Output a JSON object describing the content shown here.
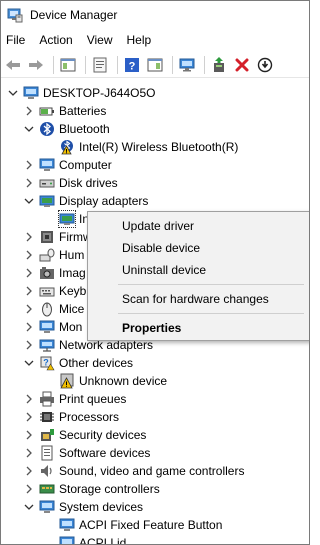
{
  "window": {
    "title": "Device Manager",
    "icon": "device-manager-icon"
  },
  "menu": {
    "file": "File",
    "action": "Action",
    "view": "View",
    "help": "Help"
  },
  "toolbar": {
    "buttons": [
      "back-arrow-icon",
      "forward-arrow-icon",
      "show-hide-tree-icon",
      "properties-icon",
      "help-icon",
      "action-pane-icon",
      "monitor-scan-icon",
      "update-driver-icon",
      "uninstall-x-icon",
      "download-circle-icon"
    ]
  },
  "tree": {
    "root": "DESKTOP-J644O5O",
    "items": [
      {
        "label": "Batteries",
        "icon": "battery-icon",
        "expanded": false
      },
      {
        "label": "Bluetooth",
        "icon": "bluetooth-icon",
        "expanded": true
      },
      {
        "label": "Intel(R) Wireless Bluetooth(R)",
        "icon": "bluetooth-warning-icon",
        "child": true
      },
      {
        "label": "Computer",
        "icon": "computer-icon",
        "expanded": false
      },
      {
        "label": "Disk drives",
        "icon": "disk-drive-icon",
        "expanded": false
      },
      {
        "label": "Display adapters",
        "icon": "display-adapter-icon",
        "expanded": true
      },
      {
        "label": "In",
        "icon": "display-adapter-icon",
        "child": true
      },
      {
        "label": "Firmw",
        "icon": "firmware-icon",
        "expanded": false
      },
      {
        "label": "Hum",
        "icon": "hid-icon",
        "expanded": false
      },
      {
        "label": "Imag",
        "icon": "imaging-icon",
        "expanded": false
      },
      {
        "label": "Keyb",
        "icon": "keyboard-icon",
        "expanded": false
      },
      {
        "label": "Mice",
        "icon": "mouse-icon",
        "expanded": false
      },
      {
        "label": "Mon",
        "icon": "monitor-icon",
        "expanded": false
      },
      {
        "label": "Network adapters",
        "icon": "network-adapter-icon",
        "expanded": false
      },
      {
        "label": "Other devices",
        "icon": "other-devices-icon",
        "expanded": true
      },
      {
        "label": "Unknown device",
        "icon": "unknown-device-warning-icon",
        "child": true
      },
      {
        "label": "Print queues",
        "icon": "printer-icon",
        "expanded": false
      },
      {
        "label": "Processors",
        "icon": "processor-icon",
        "expanded": false
      },
      {
        "label": "Security devices",
        "icon": "security-device-icon",
        "expanded": false
      },
      {
        "label": "Software devices",
        "icon": "software-device-icon",
        "expanded": false
      },
      {
        "label": "Sound, video and game controllers",
        "icon": "speaker-icon",
        "expanded": false
      },
      {
        "label": "Storage controllers",
        "icon": "storage-controller-icon",
        "expanded": false
      },
      {
        "label": "System devices",
        "icon": "system-devices-icon",
        "expanded": true
      },
      {
        "label": "ACPI Fixed Feature Button",
        "icon": "system-device-icon",
        "child": true
      },
      {
        "label": "ACPI Lid",
        "icon": "system-device-icon",
        "child": true
      }
    ]
  },
  "context_menu": {
    "update_driver": "Update driver",
    "disable_device": "Disable device",
    "uninstall_device": "Uninstall device",
    "scan": "Scan for hardware changes",
    "properties": "Properties"
  },
  "colors": {
    "accent_blue": "#1a6fd1",
    "warning_yellow": "#f2c000",
    "delete_red": "#d4202a",
    "selection_green": "#2e8b57"
  }
}
